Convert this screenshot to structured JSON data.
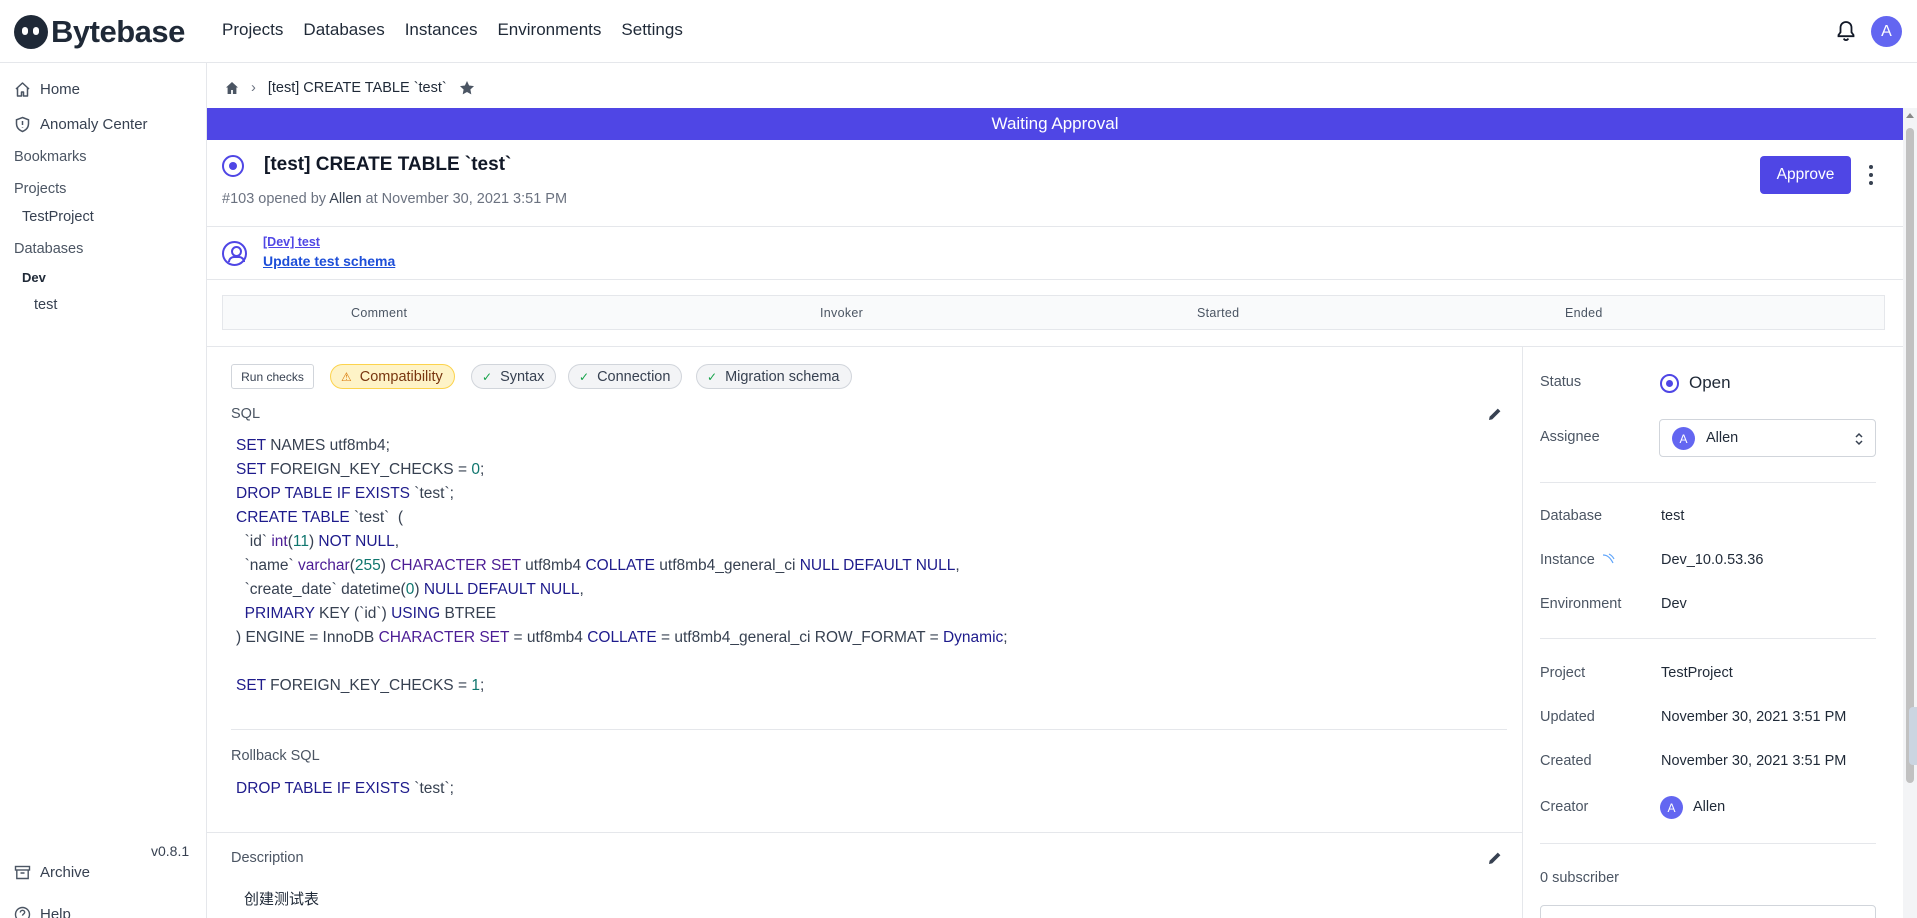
{
  "app": {
    "name": "Bytebase"
  },
  "nav": {
    "projects": "Projects",
    "databases": "Databases",
    "instances": "Instances",
    "environments": "Environments",
    "settings": "Settings"
  },
  "user": {
    "avatar_letter": "A"
  },
  "sidebar": {
    "home": "Home",
    "anomaly_center": "Anomaly Center",
    "bookmarks": "Bookmarks",
    "projects_heading": "Projects",
    "project_item": "TestProject",
    "databases_heading": "Databases",
    "env_item": "Dev",
    "db_item": "test",
    "archive": "Archive",
    "help": "Help",
    "version": "v0.8.1"
  },
  "breadcrumb": {
    "title": "[test] CREATE TABLE `test`"
  },
  "banner": {
    "text": "Waiting Approval",
    "color": "#4f46e5"
  },
  "issue": {
    "title": "[test] CREATE TABLE `test`",
    "number": "#103",
    "opened_by_text": "opened by",
    "author": "Allen",
    "at_text": "at",
    "created_at": "November 30, 2021 3:51 PM",
    "approve_label": "Approve"
  },
  "stage": {
    "env_db": "[Dev] test",
    "task": "Update test schema"
  },
  "task_table": {
    "columns": [
      "Comment",
      "Invoker",
      "Started",
      "Ended"
    ]
  },
  "checks": {
    "run_label": "Run checks",
    "items": [
      {
        "label": "Compatibility",
        "status": "warning"
      },
      {
        "label": "Syntax",
        "status": "success"
      },
      {
        "label": "Connection",
        "status": "success"
      },
      {
        "label": "Migration schema",
        "status": "success"
      }
    ]
  },
  "sql": {
    "label": "SQL",
    "lines": [
      "SET NAMES utf8mb4;",
      "SET FOREIGN_KEY_CHECKS = 0;",
      "DROP TABLE IF EXISTS `test`;",
      "CREATE TABLE `test`  (",
      "  `id` int(11) NOT NULL,",
      "  `name` varchar(255) CHARACTER SET utf8mb4 COLLATE utf8mb4_general_ci NULL DEFAULT NULL,",
      "  `create_date` datetime(0) NULL DEFAULT NULL,",
      "  PRIMARY KEY (`id`) USING BTREE",
      ") ENGINE = InnoDB CHARACTER SET = utf8mb4 COLLATE = utf8mb4_general_ci ROW_FORMAT = Dynamic;",
      "",
      "SET FOREIGN_KEY_CHECKS = 1;"
    ]
  },
  "rollback": {
    "label": "Rollback SQL",
    "lines": [
      "DROP TABLE IF EXISTS `test`;"
    ]
  },
  "description": {
    "label": "Description",
    "text": "创建测试表"
  },
  "details": {
    "status_label": "Status",
    "status_value": "Open",
    "assignee_label": "Assignee",
    "assignee_value": "Allen",
    "assignee_letter": "A",
    "database_label": "Database",
    "database_value": "test",
    "instance_label": "Instance",
    "instance_value": "Dev_10.0.53.36",
    "environment_label": "Environment",
    "environment_value": "Dev",
    "project_label": "Project",
    "project_value": "TestProject",
    "updated_label": "Updated",
    "updated_value": "November 30, 2021 3:51 PM",
    "created_label": "Created",
    "created_value": "November 30, 2021 3:51 PM",
    "creator_label": "Creator",
    "creator_value": "Allen",
    "creator_letter": "A",
    "subscriber_text": "0 subscriber"
  }
}
